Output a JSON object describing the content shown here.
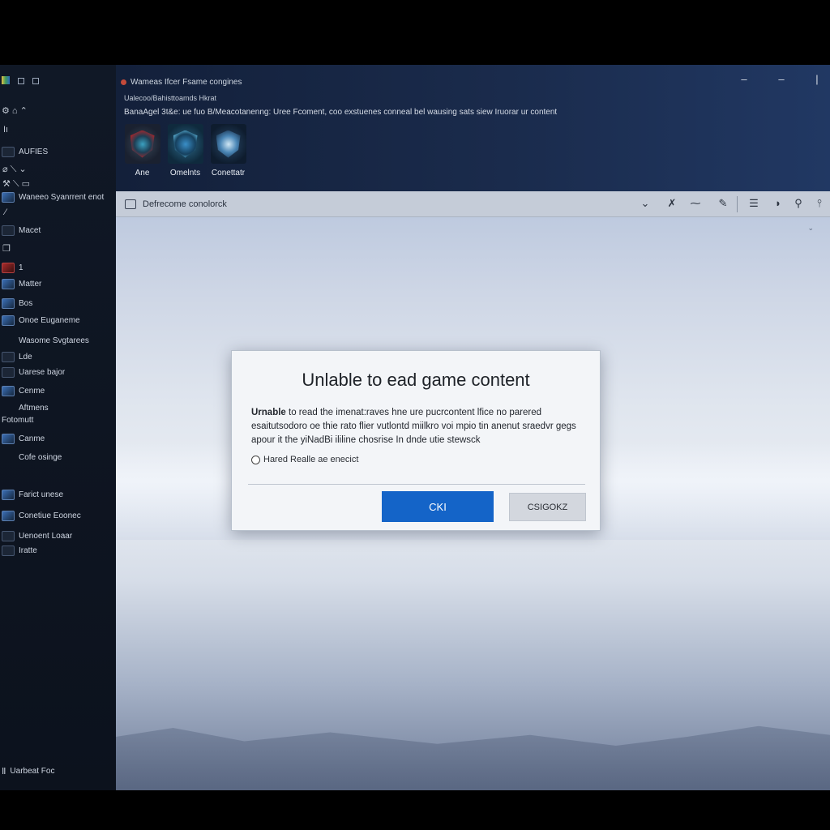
{
  "header": {
    "app_title": "Wameas Ifcer Fsame congines",
    "subtitle": "Ualecoo/Bahisttoamds Hkrat",
    "description": "BanaAgel 3t&e: ue fuo B/Meacotanenng: Uree Fcoment, coo exstuenes conneal bel wausing sats siew Iruorar ur content",
    "window_controls": [
      "–",
      "–",
      "|"
    ]
  },
  "games": [
    {
      "label": "Ane"
    },
    {
      "label": "Omelnts"
    },
    {
      "label": "Conettatr"
    }
  ],
  "sidebar": {
    "items": [
      {
        "label": "AUFIES"
      },
      {
        "label": "Waneeo Syanrrent enot"
      },
      {
        "label": "Macet"
      },
      {
        "label": "1"
      },
      {
        "label": "Matter"
      },
      {
        "label": "Bos"
      },
      {
        "label": "Onoe Euganeme"
      },
      {
        "label": "Wasome Svgtarees"
      },
      {
        "label": "Lde"
      },
      {
        "label": "Uarese bajor"
      },
      {
        "label": "Cenme"
      },
      {
        "label": "Aftmens"
      },
      {
        "label": "Fotomutt"
      },
      {
        "label": "Canme"
      },
      {
        "label": "Cofe osinge"
      },
      {
        "label": "Farict unese"
      },
      {
        "label": "Conetiue Eoonec"
      },
      {
        "label": "Uenoent Loaar"
      },
      {
        "label": "Iratte"
      }
    ],
    "footer": "Uarbeat Foc"
  },
  "toolbar": {
    "label": "Defrecome conolorck"
  },
  "dialog": {
    "title": "Unlable to ead game content",
    "body_lead": "Urnable",
    "body_rest": " to read the imenat:raves hne ure pucrcontent lfice no parered esaitutsodoro oe thie rato flier vutlontd miilkro voi mpio tin anenut sraedvr gegs apour it the yiNadBi ililine chosrise In dnde utie stewsck",
    "checkbox_label": "Hared Realle ae enecict",
    "ok_label": "CKI",
    "cancel_label": "CSIGOKZ"
  }
}
